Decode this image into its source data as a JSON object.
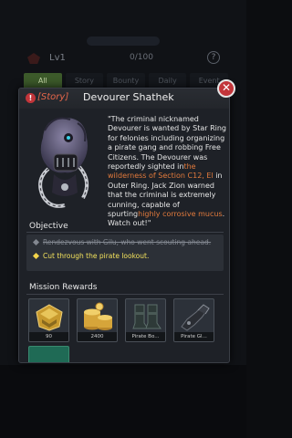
{
  "background": {
    "level": "Lv1",
    "quest_count": "0/100",
    "help": "?",
    "tabs": [
      {
        "label": "All"
      },
      {
        "label": "Story"
      },
      {
        "label": "Bounty"
      },
      {
        "label": "Daily"
      },
      {
        "label": "Event"
      }
    ]
  },
  "modal": {
    "close": "✕",
    "badge": "!",
    "tag": "[Story]",
    "title": "Devourer Shathek",
    "description": {
      "part1": "\"The criminal nicknamed Devourer is wanted by Star Ring for felonies including organizing a pirate gang and robbing Free Citizens. The Devourer was reportedly sighted in",
      "hl1": "the wilderness of Section C12, El",
      "part2": " in Outer Ring. Jack Zion warned that the criminal is extremely cunning, capable of spurting",
      "hl2": "highly corrosive mucus",
      "part3": ". Watch out!\""
    },
    "objective_label": "Objective",
    "objectives": [
      {
        "text": "Rendezvous with Gilu, who went scouting ahead.",
        "state": "done"
      },
      {
        "text": "Cut through the pirate lookout.",
        "state": "active"
      }
    ],
    "rewards_label": "Mission Rewards",
    "rewards": [
      {
        "name": "rank-badge",
        "caption": "90"
      },
      {
        "name": "gold-coins",
        "caption": "2400"
      },
      {
        "name": "pirate-boots",
        "caption": "Pirate Bo..."
      },
      {
        "name": "pirate-gloves",
        "caption": "Pirate Gl..."
      }
    ]
  },
  "colors": {
    "accent_red": "#c2353a",
    "highlight_orange": "#e27a3c",
    "objective_yellow": "#f2e15c"
  }
}
